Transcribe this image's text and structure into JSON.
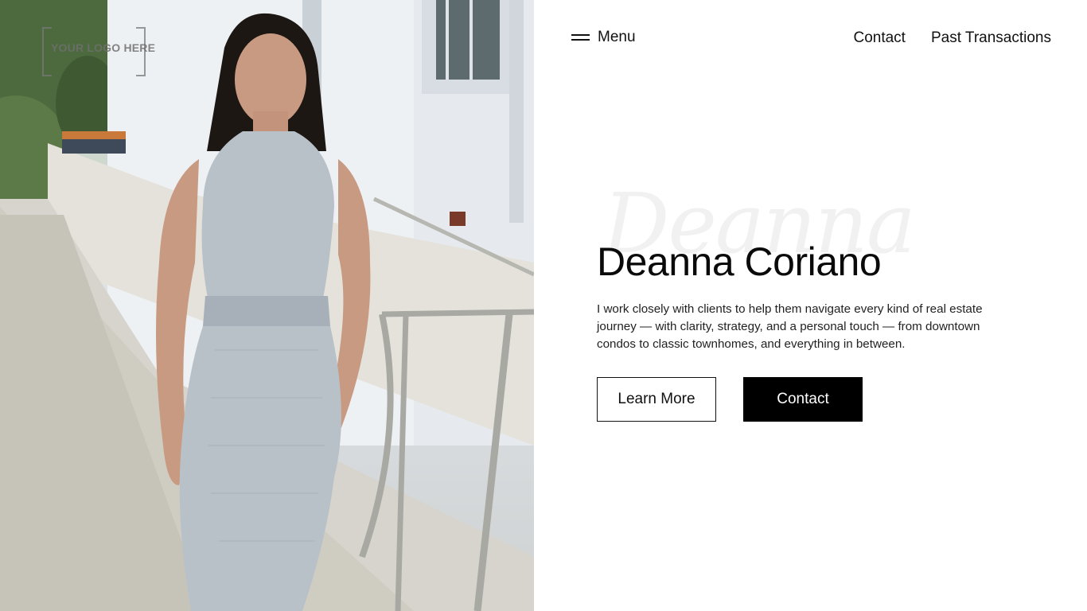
{
  "logo": {
    "text": "YOUR LOGO HERE"
  },
  "nav": {
    "menu_label": "Menu",
    "links": [
      "Contact",
      "Past Transactions"
    ]
  },
  "hero": {
    "script_name": "Deanna",
    "name": "Deanna Coriano",
    "bio": "I work closely with clients to help them navigate every kind of real estate journey — with clarity, strategy, and a personal touch — from downtown condos to classic townhomes, and everything in between.",
    "buttons": {
      "learn_more": "Learn More",
      "contact": "Contact"
    }
  },
  "icons": {
    "menu": "hamburger-icon"
  },
  "colors": {
    "accent": "#000000",
    "background": "#ffffff",
    "text": "#111111"
  }
}
